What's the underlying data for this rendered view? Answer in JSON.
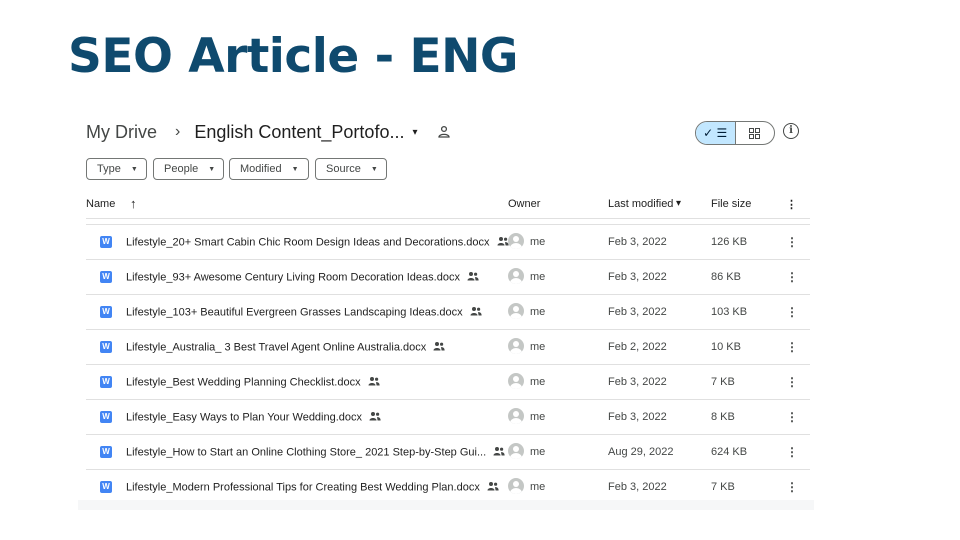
{
  "slide": {
    "title": "SEO Article - ENG"
  },
  "breadcrumb": {
    "root": "My Drive",
    "separator": "›",
    "folder": "English Content_Portofo...",
    "caret": "▾"
  },
  "filters": [
    {
      "label": "Type"
    },
    {
      "label": "People"
    },
    {
      "label": "Modified"
    },
    {
      "label": "Source"
    }
  ],
  "columns": {
    "name": "Name",
    "sort_icon": "↑",
    "owner": "Owner",
    "modified": "Last modified",
    "modified_sort": "▾",
    "size": "File size",
    "more": "⋮"
  },
  "files": [
    {
      "name": "Lifestyle_20+ Smart Cabin Chic Room Design Ideas and Decorations.docx",
      "owner": "me",
      "modified": "Feb 3, 2022",
      "size": "126 KB"
    },
    {
      "name": "Lifestyle_93+ Awesome Century Living Room Decoration Ideas.docx",
      "owner": "me",
      "modified": "Feb 3, 2022",
      "size": "86 KB"
    },
    {
      "name": "Lifestyle_103+ Beautiful Evergreen Grasses Landscaping Ideas.docx",
      "owner": "me",
      "modified": "Feb 3, 2022",
      "size": "103 KB"
    },
    {
      "name": "Lifestyle_Australia_ 3 Best Travel Agent Online Australia.docx",
      "owner": "me",
      "modified": "Feb 2, 2022",
      "size": "10 KB"
    },
    {
      "name": "Lifestyle_Best Wedding Planning Checklist.docx",
      "owner": "me",
      "modified": "Feb 3, 2022",
      "size": "7 KB"
    },
    {
      "name": "Lifestyle_Easy Ways to Plan Your Wedding.docx",
      "owner": "me",
      "modified": "Feb 3, 2022",
      "size": "8 KB"
    },
    {
      "name": "Lifestyle_How to Start an Online Clothing Store_ 2021 Step-by-Step Gui...",
      "owner": "me",
      "modified": "Aug 29, 2022",
      "size": "624 KB"
    },
    {
      "name": "Lifestyle_Modern Professional Tips for Creating Best Wedding Plan.docx",
      "owner": "me",
      "modified": "Feb 3, 2022",
      "size": "7 KB"
    }
  ],
  "icons": {
    "file": "docs-w-icon",
    "doc_letter": "W",
    "shared": "people-icon",
    "owner": "avatar-icon",
    "more": "⋮",
    "info": "i",
    "list_view": "✓ ☰"
  },
  "colors": {
    "title": "#0f4a6e",
    "accent_toggle": "#c2e7ff",
    "doc_icon": "#4285f4"
  }
}
